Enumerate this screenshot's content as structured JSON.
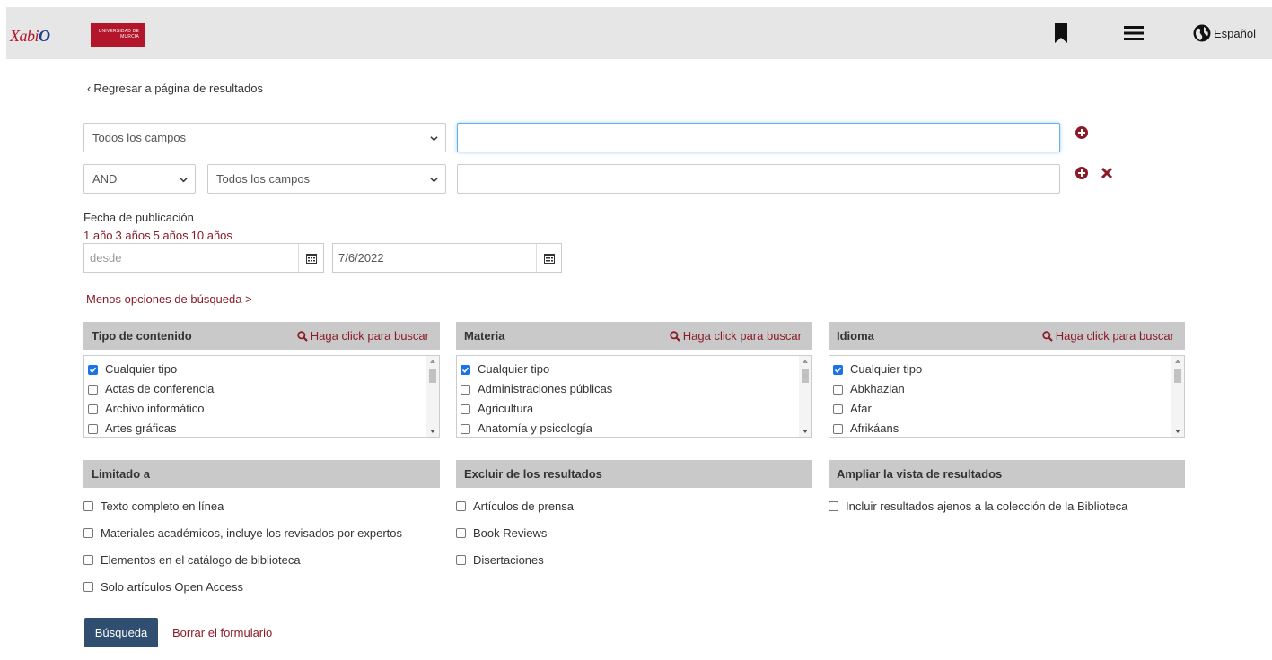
{
  "header": {
    "logo_xabio_a": "Xabi",
    "logo_xabio_b": "O",
    "logo_um_line1": "UNIVERSIDAD DE",
    "logo_um_line2": "MURCIA",
    "language": "Español"
  },
  "back_link": "Regresar a página de resultados",
  "query": {
    "row1_field": "Todos los campos",
    "row1_value": "",
    "row2_operator": "AND",
    "row2_field": "Todos los campos",
    "row2_value": ""
  },
  "date": {
    "label": "Fecha de publicación",
    "presets": [
      "1 año",
      "3 años",
      "5 años",
      "10 años"
    ],
    "from_placeholder": "desde",
    "to_value": "7/6/2022"
  },
  "less_options": "Menos opciones de búsqueda >",
  "search_link": "Haga click para buscar",
  "facets": [
    {
      "title": "Tipo de contenido",
      "items": [
        {
          "label": "Cualquier tipo",
          "checked": true
        },
        {
          "label": "Actas de conferencia",
          "checked": false
        },
        {
          "label": "Archivo informático",
          "checked": false
        },
        {
          "label": "Artes gráficas",
          "checked": false
        }
      ]
    },
    {
      "title": "Materia",
      "items": [
        {
          "label": "Cualquier tipo",
          "checked": true
        },
        {
          "label": "Administraciones públicas",
          "checked": false
        },
        {
          "label": "Agricultura",
          "checked": false
        },
        {
          "label": "Anatomía y psicología",
          "checked": false
        }
      ]
    },
    {
      "title": "Idioma",
      "items": [
        {
          "label": "Cualquier tipo",
          "checked": true
        },
        {
          "label": "Abkhazian",
          "checked": false
        },
        {
          "label": "Afar",
          "checked": false
        },
        {
          "label": "Afrikáans",
          "checked": false
        }
      ]
    }
  ],
  "limits": {
    "limited_title": "Limitado a",
    "limited": [
      "Texto completo en línea",
      "Materiales académicos, incluye los revisados por expertos",
      "Elementos en el catálogo de biblioteca",
      "Solo artículos Open Access"
    ],
    "exclude_title": "Excluir de los resultados",
    "exclude": [
      "Artículos de prensa",
      "Book Reviews",
      "Disertaciones"
    ],
    "expand_title": "Ampliar la vista de resultados",
    "expand": [
      "Incluir resultados ajenos a la colección de la Biblioteca"
    ]
  },
  "buttons": {
    "search": "Búsqueda",
    "clear": "Borrar el formulario"
  },
  "colors": {
    "accent_red": "#8a1c28",
    "button_blue": "#2f4e70",
    "panel_header": "#c9c9c9"
  }
}
